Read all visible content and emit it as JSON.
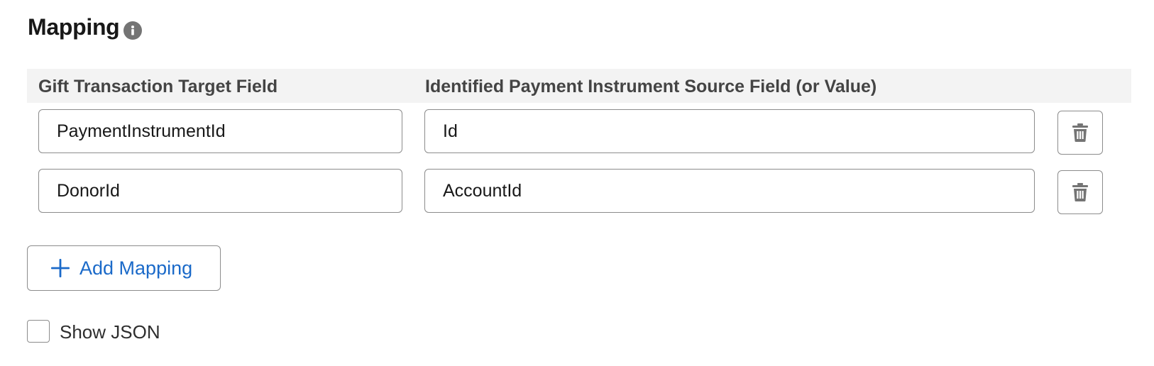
{
  "section": {
    "title": "Mapping",
    "info_icon": "info-icon"
  },
  "table": {
    "headers": {
      "target": "Gift Transaction Target Field",
      "source": "Identified Payment Instrument Source Field (or Value)"
    },
    "rows": [
      {
        "target": "PaymentInstrumentId",
        "source": "Id",
        "action_icon": "trash-icon"
      },
      {
        "target": "DonorId",
        "source": "AccountId",
        "action_icon": "trash-icon"
      }
    ]
  },
  "add_button": {
    "label": "Add Mapping",
    "icon": "plus-icon"
  },
  "show_json": {
    "label": "Show JSON",
    "checked": false
  },
  "colors": {
    "accent": "#1b6ac9",
    "border": "#8c8c8c",
    "header_bg": "#f3f3f3",
    "icon_gray": "#747474"
  }
}
